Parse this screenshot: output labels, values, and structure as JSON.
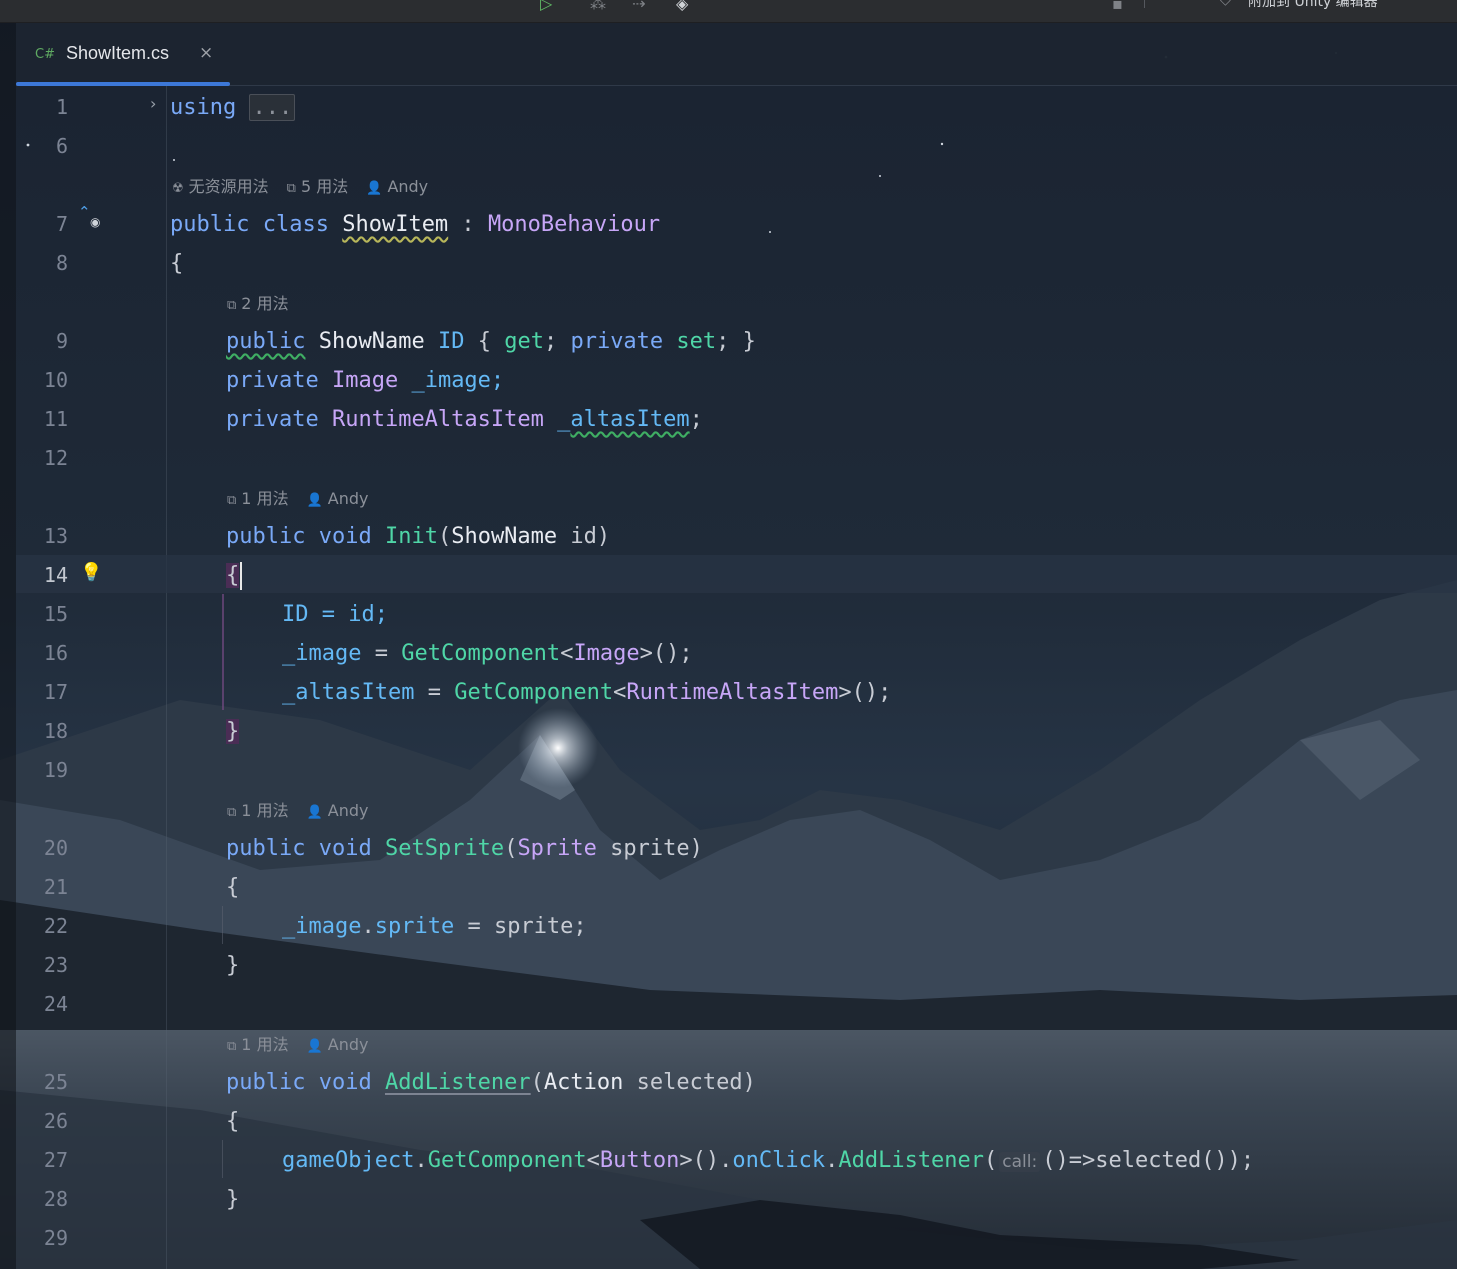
{
  "toolbar": {
    "run_icon": "play-icon",
    "debug_icon": "bug-icon",
    "attach_label": "附加到 Unity 编辑器"
  },
  "tab": {
    "lang_badge": "C#",
    "file_name": "ShowItem.cs",
    "close_glyph": "×"
  },
  "editor": {
    "line_numbers": [
      "1",
      "6",
      "7",
      "8",
      "9",
      "10",
      "11",
      "12",
      "13",
      "14",
      "15",
      "16",
      "17",
      "18",
      "19",
      "20",
      "21",
      "22",
      "23",
      "24",
      "25",
      "26",
      "27",
      "28",
      "29"
    ],
    "hints": {
      "class_no_asset": "无资源用法",
      "class_usages": "5 用法",
      "class_author": "Andy",
      "id_usages": "2 用法",
      "init_usages": "1 用法",
      "init_author": "Andy",
      "setsprite_usages": "1 用法",
      "setsprite_author": "Andy",
      "addlistener_usages": "1 用法",
      "addlistener_author": "Andy"
    },
    "code": {
      "l1_kw": "using",
      "l1_fold": "...",
      "l7_public": "public",
      "l7_class": "class",
      "l7_name": "ShowItem",
      "l7_colon": " : ",
      "l7_base": "MonoBehaviour",
      "l8": "{",
      "l9_public": "public",
      "l9_type": "ShowName",
      "l9_prop": "ID",
      "l9_open": "{ ",
      "l9_get": "get",
      "l9_semi1": "; ",
      "l9_private": "private",
      "l9_set": "set",
      "l9_end": "; }",
      "l10_private": "private",
      "l10_type": "Image",
      "l10_field": "_image;",
      "l11_private": "private",
      "l11_type": "RuntimeAltasItem",
      "l11_field_pre": "_",
      "l11_field_sq": "altasItem",
      "l11_semi": ";",
      "l13_public": "public",
      "l13_void": "void",
      "l13_fn": "Init",
      "l13_paren": "(",
      "l13_ptype": "ShowName",
      "l13_pname": " id)",
      "l14": "{",
      "l15": "ID = id;",
      "l16_field": "_image",
      "l16_eq": " = ",
      "l16_fn": "GetComponent",
      "l16_lt": "<",
      "l16_ty": "Image",
      "l16_end": ">();",
      "l17_field": "_altasItem",
      "l17_eq": " = ",
      "l17_fn": "GetComponent",
      "l17_lt": "<",
      "l17_ty": "RuntimeAltasItem",
      "l17_end": ">();",
      "l18": "}",
      "l20_public": "public",
      "l20_void": "void",
      "l20_fn": "SetSprite",
      "l20_paren": "(",
      "l20_ptype": "Sprite",
      "l20_pname": " sprite)",
      "l21": "{",
      "l22_field": "_image",
      "l22_dot": ".",
      "l22_prop": "sprite",
      "l22_end": " = sprite;",
      "l23": "}",
      "l25_public": "public",
      "l25_void": "void",
      "l25_fn": "AddListener",
      "l25_paren": "(",
      "l25_ptype": "Action",
      "l25_pname": " selected)",
      "l26": "{",
      "l27_obj": "gameObject",
      "l27_dot1": ".",
      "l27_fn1": "GetComponent",
      "l27_lt": "<",
      "l27_ty": "Button",
      "l27_mid": ">().",
      "l27_prop": "onClick",
      "l27_dot2": ".",
      "l27_fn2": "AddListener",
      "l27_paren": "(",
      "l27_hint": "call:",
      "l27_end": "()=>selected());",
      "l28": "}"
    }
  },
  "colors": {
    "keyword": "#7aa9f7",
    "type": "#c7a6f7",
    "method": "#4fd6a7",
    "property": "#64b9f5",
    "tab_underline": "#3d78d8"
  }
}
